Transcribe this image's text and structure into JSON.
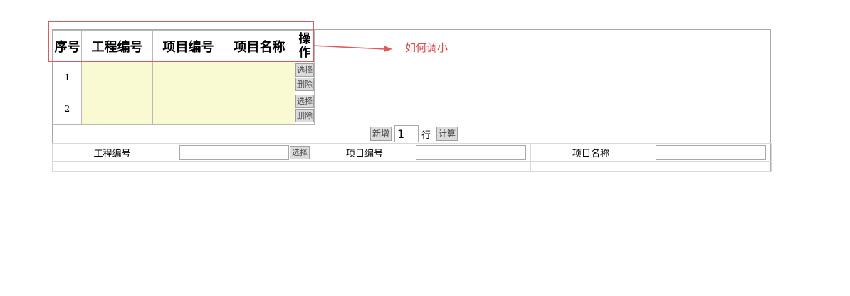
{
  "grid": {
    "headers": {
      "seq": "序号",
      "project_code": "工程编号",
      "item_code": "项目编号",
      "item_name": "项目名称",
      "operation_line1": "操",
      "operation_line2": "作"
    },
    "rows": [
      {
        "seq": "1",
        "select_label": "选择",
        "delete_label": "删除"
      },
      {
        "seq": "2",
        "select_label": "选择",
        "delete_label": "删除"
      }
    ]
  },
  "toolbar": {
    "add_label": "新增",
    "row_count_value": "1",
    "row_unit": "行",
    "calc_label": "计算"
  },
  "form": {
    "project_code_label": "工程编号",
    "project_code_value": "",
    "select_label": "选择",
    "item_code_label": "项目编号",
    "item_code_value": "",
    "item_name_label": "项目名称",
    "item_name_value": ""
  },
  "annotation": {
    "text": "如何调小",
    "color": "#d94a4a"
  },
  "colors": {
    "cell_fill": "#f9f9d2",
    "button_bg": "#dcdcdc",
    "highlight_border": "#e05a5a"
  }
}
